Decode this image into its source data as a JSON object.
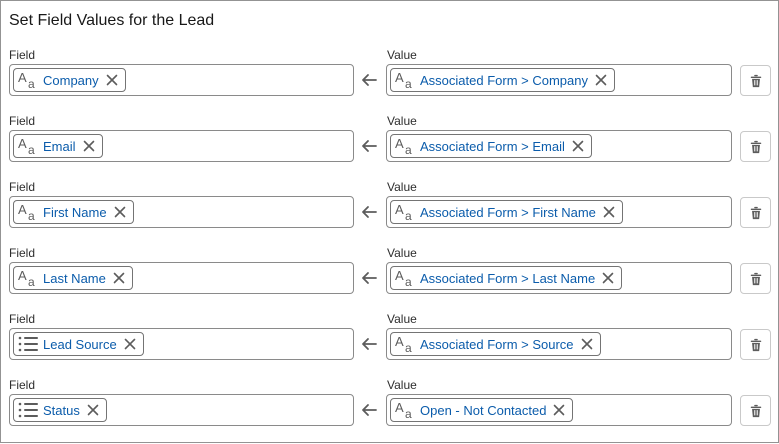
{
  "header": {
    "title": "Set Field Values for the Lead"
  },
  "labels": {
    "field": "Field",
    "value": "Value"
  },
  "icons": {
    "text": "text-type-icon",
    "picklist": "picklist-type-icon",
    "remove": "close-icon",
    "arrow": "arrow-left-icon",
    "delete": "trash-icon"
  },
  "colors": {
    "pill_text": "#0b5cab",
    "border": "#8a8a8a",
    "icon": "#5c5c5c"
  },
  "rows": [
    {
      "field": "Company",
      "field_type": "text",
      "value": "Associated Form > Company",
      "value_type": "text"
    },
    {
      "field": "Email",
      "field_type": "text",
      "value": "Associated Form > Email",
      "value_type": "text"
    },
    {
      "field": "First Name",
      "field_type": "text",
      "value": "Associated Form > First Name",
      "value_type": "text"
    },
    {
      "field": "Last Name",
      "field_type": "text",
      "value": "Associated Form > Last Name",
      "value_type": "text"
    },
    {
      "field": "Lead Source",
      "field_type": "picklist",
      "value": "Associated Form > Source",
      "value_type": "text"
    },
    {
      "field": "Status",
      "field_type": "picklist",
      "value": "Open - Not Contacted",
      "value_type": "text"
    }
  ]
}
